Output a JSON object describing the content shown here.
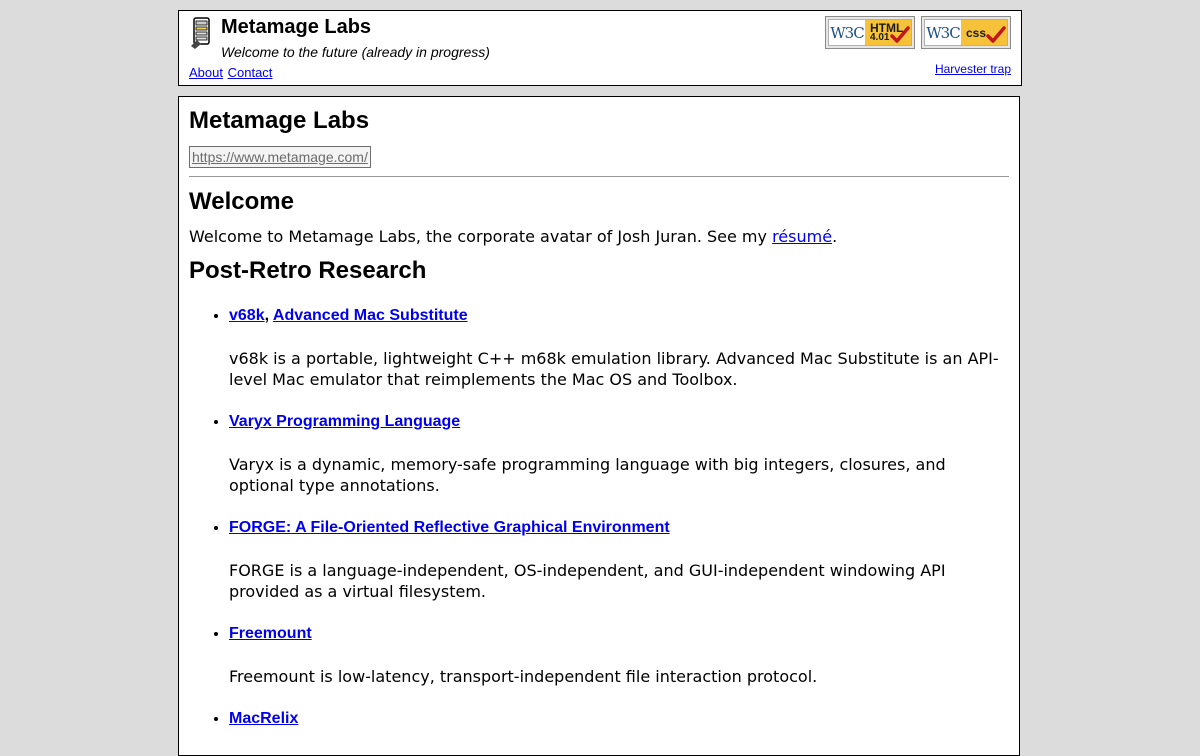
{
  "header": {
    "title": "Metamage Labs",
    "tagline": "Welcome to the future (already in progress)",
    "nav": [
      "About",
      "Contact"
    ],
    "harvester": "Harvester trap",
    "badges": [
      {
        "w3c": "W3C",
        "tech": "HTML",
        "version": "4.01"
      },
      {
        "w3c": "W3C",
        "tech": "css",
        "version": ""
      }
    ]
  },
  "main": {
    "title": "Metamage Labs",
    "url": "https://www.metamage.com/",
    "welcome_heading": "Welcome",
    "welcome_text_before": "Welcome to Metamage Labs, the corporate avatar of Josh Juran. See my ",
    "welcome_link": "résumé",
    "welcome_text_after": ".",
    "research_heading": "Post-Retro Research",
    "projects": [
      {
        "title": "v68k",
        "title_sep": ", ",
        "title2": "Advanced Mac Substitute",
        "desc": "v68k is a portable, lightweight C++ m68k emulation library. Advanced Mac Substitute is an API-level Mac emulator that reimplements the Mac OS and Toolbox."
      },
      {
        "title": "Varyx Programming Language",
        "desc": "Varyx is a dynamic, memory-safe programming language with big integers, closures, and optional type annotations."
      },
      {
        "title": "FORGE: A File-Oriented Reflective Graphical Environment",
        "desc": "FORGE is a language-independent, OS-independent, and GUI-independent windowing API provided as a virtual filesystem."
      },
      {
        "title": "Freemount",
        "desc": "Freemount is low-latency, transport-independent file interaction protocol."
      },
      {
        "title": "MacRelix",
        "desc": ""
      }
    ]
  },
  "colors": {
    "page_bg": "#dcdcdc",
    "link": "#0000ee",
    "badge_yellow": "#f6c23a",
    "w3c_blue": "#1d4e89",
    "tick_red": "#c0181a"
  },
  "icons": {
    "logo": "metamage-logo-icon",
    "badge_check": "checkmark-icon"
  }
}
